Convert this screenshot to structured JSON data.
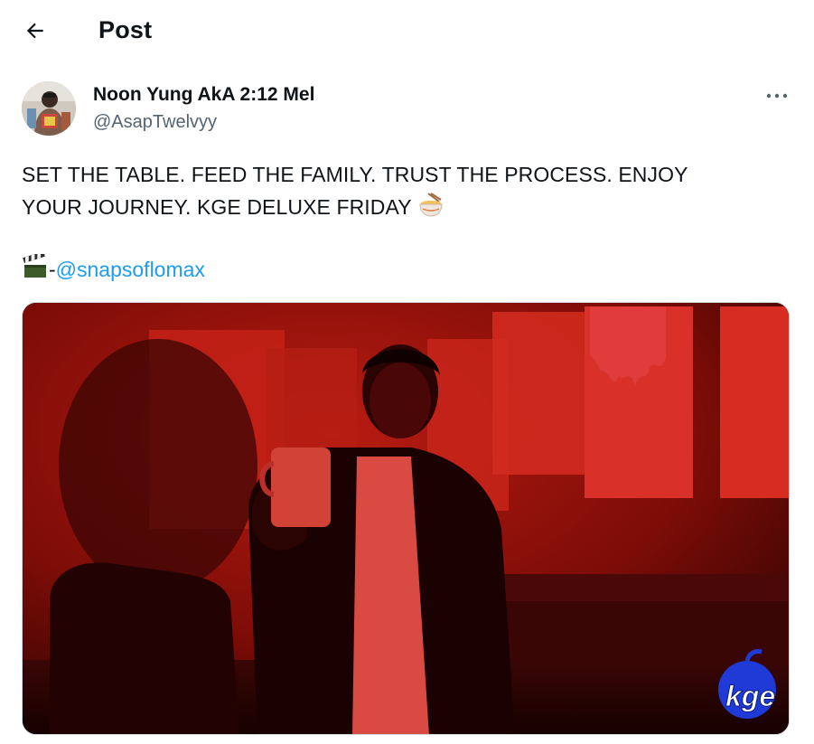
{
  "header": {
    "title": "Post",
    "back_icon": "arrow-left-icon"
  },
  "author": {
    "name": "Noon Yung AkA 2:12 Mel",
    "handle": "@AsapTwelvyy"
  },
  "more_icon": "more-horizontal-icon",
  "post": {
    "line1": "SET THE TABLE. FEED THE FAMILY. TRUST THE PROCESS. ENJOY",
    "line2": "YOUR JOURNEY. KGE DELUXE FRIDAY",
    "line2_emoji": "noodle-bowl-emoji",
    "credit_emoji": "clapper-board-emoji",
    "credit_dash": "-",
    "mention": "@snapsoflomax"
  },
  "media": {
    "watermark": "kge",
    "accent_color": "#d42a1f"
  },
  "colors": {
    "link": "#1d9bf0",
    "secondary_text": "#536471"
  }
}
